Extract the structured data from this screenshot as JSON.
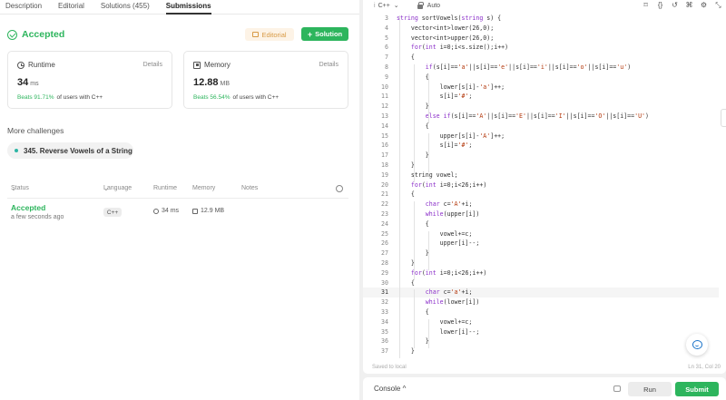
{
  "tabs": [
    "Description",
    "Editorial",
    "Solutions (455)",
    "Submissions"
  ],
  "status": {
    "label": "Accepted",
    "editorial_btn": "Editorial",
    "solution_btn": "Solution"
  },
  "runtime": {
    "title": "Runtime",
    "details": "Details",
    "value": "34",
    "unit": "ms",
    "beats_pct": "Beats 91.71%",
    "beats_text": "of users with C++"
  },
  "memory": {
    "title": "Memory",
    "details": "Details",
    "value": "12.88",
    "unit": "MB",
    "beats_pct": "Beats 56.54%",
    "beats_text": "of users with C++"
  },
  "more_challenges": {
    "heading": "More challenges",
    "item": "345. Reverse Vowels of a String"
  },
  "submissions": {
    "columns": [
      "Status",
      "Language",
      "Runtime",
      "Memory",
      "Notes"
    ],
    "row": {
      "status": "Accepted",
      "time": "a few seconds ago",
      "language": "C++",
      "runtime": "34 ms",
      "memory": "12.9 MB"
    }
  },
  "editor": {
    "language": "C++",
    "mode": "Auto",
    "saved": "Saved to local",
    "cursor": "Ln 31, Col 20",
    "code": [
      {
        "n": "3",
        "html": "<span class=\"k\">string</span> sortVowels(<span class=\"k\">string</span> s) {"
      },
      {
        "n": "4",
        "html": "    vector&lt;int&gt;lower(26,0);"
      },
      {
        "n": "5",
        "html": "    vector&lt;int&gt;upper(26,0);"
      },
      {
        "n": "6",
        "html": "    <span class=\"k\">for</span>(<span class=\"k\">int</span> i=0;i&lt;s.size();i++)"
      },
      {
        "n": "7",
        "html": "    {"
      },
      {
        "n": "8",
        "html": "        <span class=\"k\">if</span>(s[i]==<span class=\"s\">'a'</span>||s[i]==<span class=\"s\">'e'</span>||s[i]==<span class=\"s\">'i'</span>||s[i]==<span class=\"s\">'o'</span>||s[i]==<span class=\"s\">'u'</span>)"
      },
      {
        "n": "9",
        "html": "        {"
      },
      {
        "n": "10",
        "html": "            lower[s[i]-<span class=\"s\">'a'</span>]++;"
      },
      {
        "n": "11",
        "html": "            s[i]=<span class=\"s\">'#'</span>;"
      },
      {
        "n": "12",
        "html": "        }"
      },
      {
        "n": "13",
        "html": "        <span class=\"k\">else if</span>(s[i]==<span class=\"s\">'A'</span>||s[i]==<span class=\"s\">'E'</span>||s[i]==<span class=\"s\">'I'</span>||s[i]==<span class=\"s\">'O'</span>||s[i]==<span class=\"s\">'U'</span>)"
      },
      {
        "n": "14",
        "html": "        {"
      },
      {
        "n": "15",
        "html": "            upper[s[i]-<span class=\"s\">'A'</span>]++;"
      },
      {
        "n": "16",
        "html": "            s[i]=<span class=\"s\">'#'</span>;"
      },
      {
        "n": "17",
        "html": "        }"
      },
      {
        "n": "18",
        "html": "    }"
      },
      {
        "n": "19",
        "html": "    string vowel;"
      },
      {
        "n": "20",
        "html": "    <span class=\"k\">for</span>(<span class=\"k\">int</span> i=0;i&lt;26;i++)"
      },
      {
        "n": "21",
        "html": "    {"
      },
      {
        "n": "22",
        "html": "        <span class=\"k\">char</span> c=<span class=\"s\">'A'</span>+i;"
      },
      {
        "n": "23",
        "html": "        <span class=\"k\">while</span>(upper[i])"
      },
      {
        "n": "24",
        "html": "        {"
      },
      {
        "n": "25",
        "html": "            vowel+=c;"
      },
      {
        "n": "26",
        "html": "            upper[i]--;"
      },
      {
        "n": "27",
        "html": "        }"
      },
      {
        "n": "28",
        "html": "    }"
      },
      {
        "n": "29",
        "html": "    <span class=\"k\">for</span>(<span class=\"k\">int</span> i=0;i&lt;26;i++)"
      },
      {
        "n": "30",
        "html": "    {"
      },
      {
        "n": "31",
        "html": "        <span class=\"k\">char</span> c=<span class=\"s\">'a'</span>+i;"
      },
      {
        "n": "32",
        "html": "        <span class=\"k\">while</span>(lower[i])"
      },
      {
        "n": "33",
        "html": "        {"
      },
      {
        "n": "34",
        "html": "            vowel+=c;"
      },
      {
        "n": "35",
        "html": "            lower[i]--;"
      },
      {
        "n": "36",
        "html": "        }"
      },
      {
        "n": "37",
        "html": "    }"
      }
    ]
  },
  "console": {
    "label": "Console",
    "run": "Run",
    "submit": "Submit"
  },
  "colors": {
    "accent_green": "#2db55d",
    "editorial_orange": "#d89a45",
    "keyword_purple": "#8b2fc9",
    "string_red": "#b3380c"
  }
}
